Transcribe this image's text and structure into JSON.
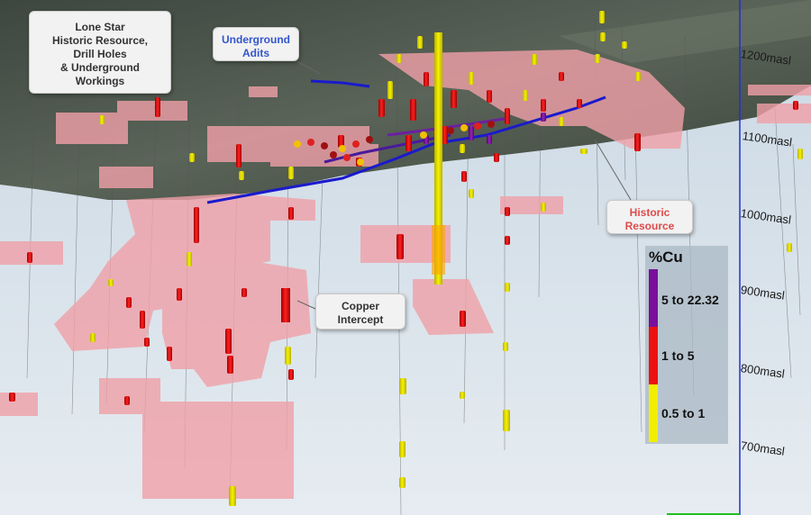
{
  "callouts": {
    "lone_star": [
      "Lone Star",
      "Historic Resource,",
      "Drill Holes",
      "& Underground",
      "Workings"
    ],
    "underground_adits": [
      "Underground",
      "Adits"
    ],
    "historic_resource": [
      "Historic",
      "Resource"
    ],
    "copper_intercept": [
      "Copper",
      "Intercept"
    ]
  },
  "legend": {
    "title": "%Cu",
    "items": [
      {
        "label": "5 to 22.32",
        "color": "#7a0f9c"
      },
      {
        "label": "1 to 5",
        "color": "#ee1111"
      },
      {
        "label": "0.5 to 1",
        "color": "#f2ee00"
      }
    ]
  },
  "elevation_labels": [
    "1200masl",
    "1100masl",
    "1000masl",
    "900masl",
    "800masl",
    "700masl"
  ],
  "colors": {
    "resource_block": "#f0a0a8",
    "adit": "#1a1acc",
    "terrain": "#4a5548",
    "sky": "#dde6ec",
    "callout_blue_text": "#3355cc",
    "callout_red_text": "#e04a4a"
  }
}
